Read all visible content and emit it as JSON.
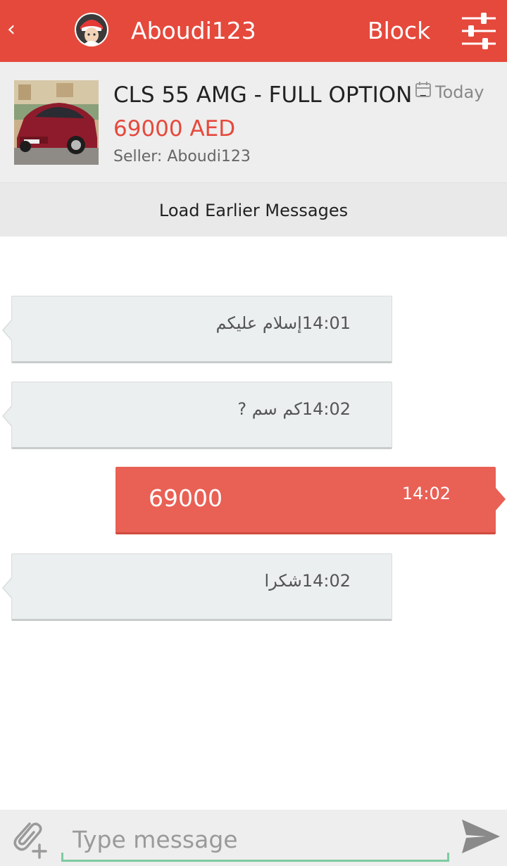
{
  "header": {
    "back_glyph": "‹",
    "title": "Aboudi123",
    "block_label": "Block",
    "icons": {
      "back": "back-chevron-icon",
      "settings": "sliders-icon"
    },
    "accent_color": "#e5493c"
  },
  "listing": {
    "title": "CLS 55 AMG - FULL OPTION -",
    "price": "69000 AED",
    "seller": "Seller: Aboudi123",
    "date": "Today"
  },
  "load_earlier_label": "Load Earlier Messages",
  "messages": [
    {
      "direction": "incoming",
      "time": "14:01",
      "text": "إسلام عليكم"
    },
    {
      "direction": "incoming",
      "time": "14:02",
      "text": "كم سم ?"
    },
    {
      "direction": "outgoing",
      "time": "14:02",
      "text": "69000"
    },
    {
      "direction": "incoming",
      "time": "14:02",
      "text": "شكرا"
    }
  ],
  "composer": {
    "placeholder": "Type message",
    "icons": {
      "attach": "paperclip-add-icon",
      "send": "send-icon"
    }
  }
}
